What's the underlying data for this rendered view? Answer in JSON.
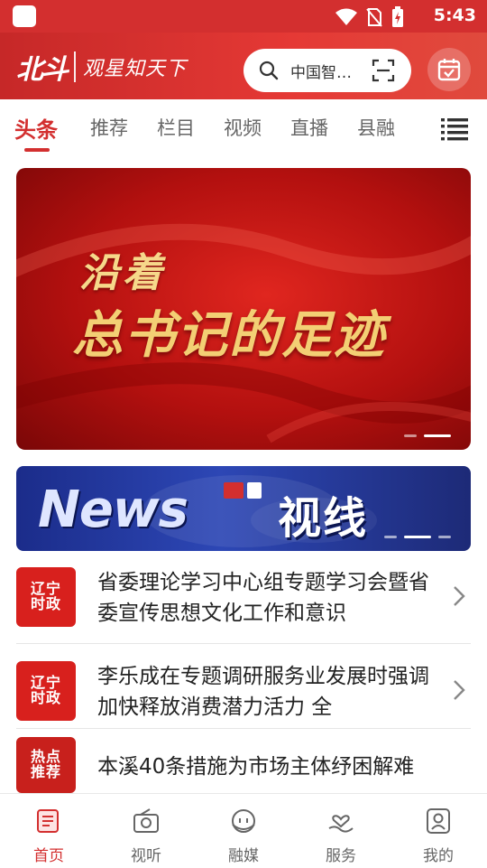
{
  "status_bar": {
    "time": "5:43"
  },
  "header": {
    "logo_text": "北斗",
    "slogan": "观星知天下",
    "search_placeholder": "中国智…"
  },
  "tabs": [
    {
      "label": "头条",
      "active": true
    },
    {
      "label": "推荐"
    },
    {
      "label": "栏目"
    },
    {
      "label": "视频"
    },
    {
      "label": "直播"
    },
    {
      "label": "县融"
    }
  ],
  "banner": {
    "line1": "沿着",
    "line2": "总书记的足迹"
  },
  "news_strip": {
    "left_text": "News",
    "title": "视线"
  },
  "news_list": [
    {
      "thumb": "辽宁时政",
      "title": "省委理论学习中心组专题学习会暨省委宣传思想文化工作和意识"
    },
    {
      "thumb": "辽宁时政",
      "title": "李乐成在专题调研服务业发展时强调 加快释放消费潜力活力 全"
    },
    {
      "thumb": "热点推荐",
      "title": "本溪40条措施为市场主体纾困解难"
    }
  ],
  "bottom_nav": [
    {
      "label": "首页",
      "icon": "home-news-icon",
      "active": true
    },
    {
      "label": "视听",
      "icon": "radio-icon"
    },
    {
      "label": "融媒",
      "icon": "chat-face-icon"
    },
    {
      "label": "服务",
      "icon": "hand-heart-icon"
    },
    {
      "label": "我的",
      "icon": "profile-icon"
    }
  ],
  "colors": {
    "brand_red": "#d32f2f"
  }
}
